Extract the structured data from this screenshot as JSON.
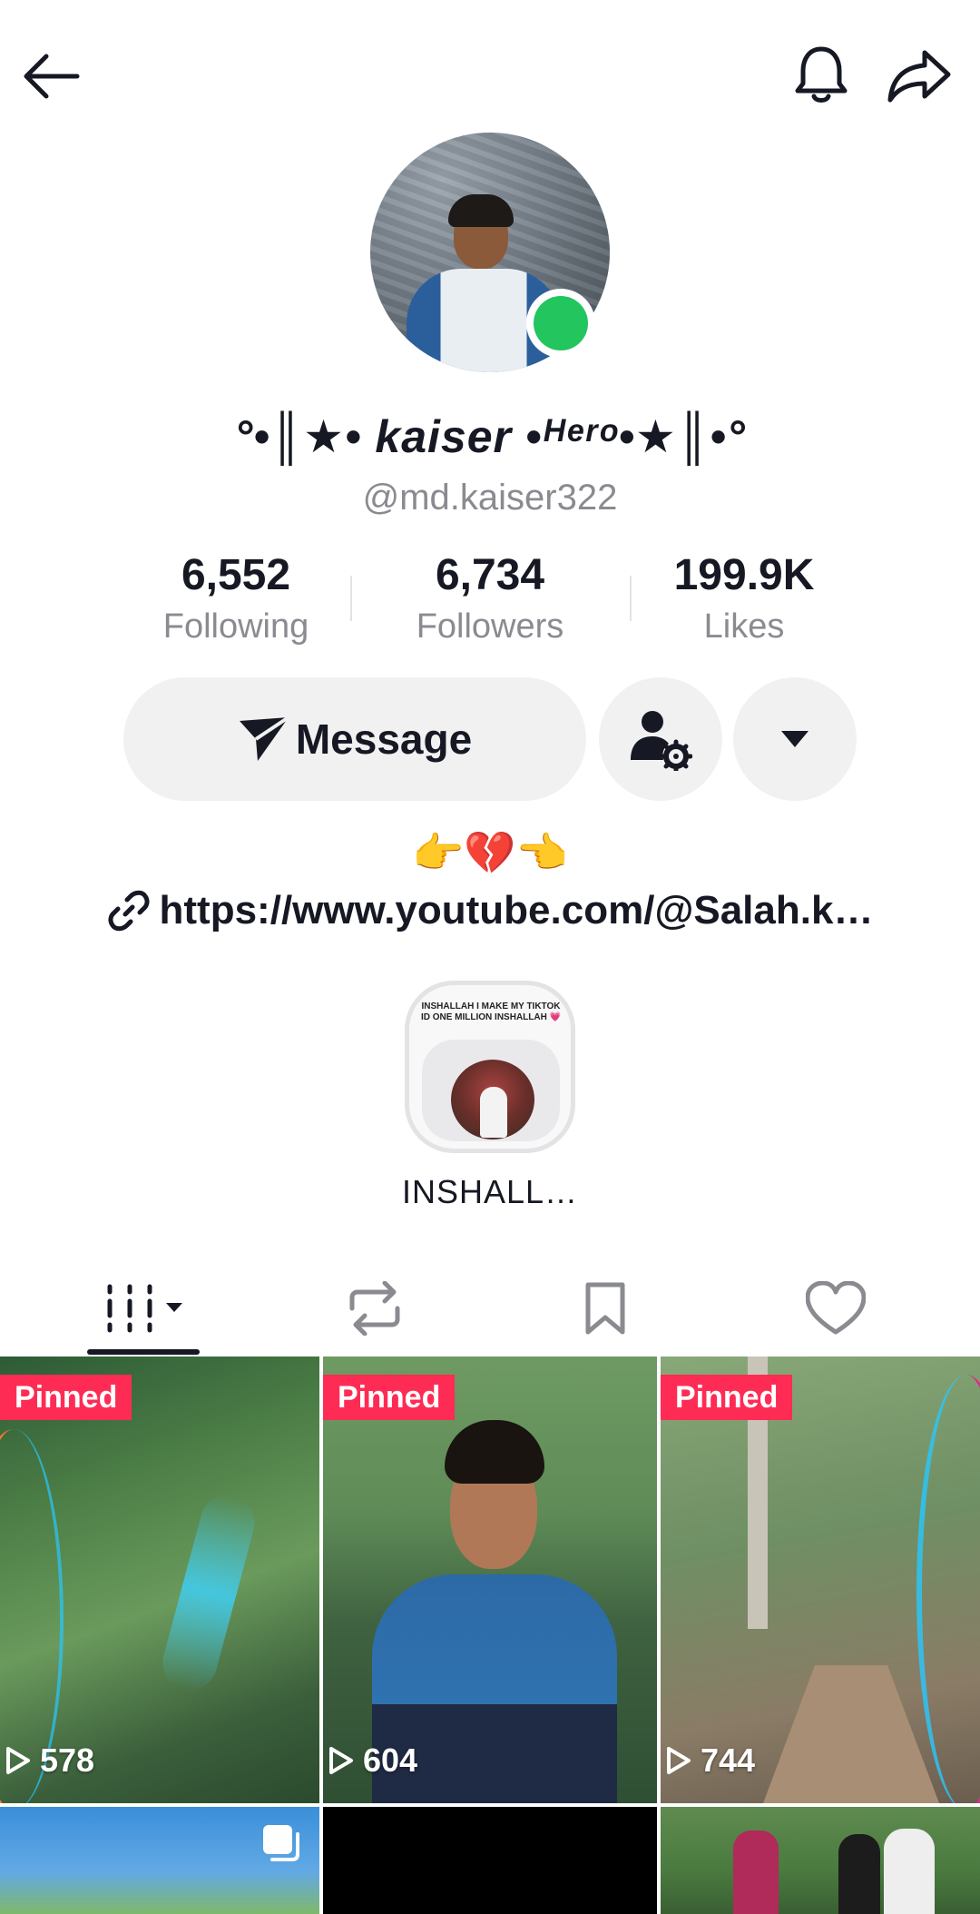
{
  "profile": {
    "display_name": "°•║★• kaiser •ᴴᵉʳᵒ•★║•°",
    "handle": "@md.kaiser322",
    "online_color": "#22c55e"
  },
  "stats": [
    {
      "value": "6,552",
      "label": "Following"
    },
    {
      "value": "6,734",
      "label": "Followers"
    },
    {
      "value": "199.9K",
      "label": "Likes"
    }
  ],
  "actions": {
    "message_label": "Message",
    "follow_icon": "user-settings-icon",
    "more_icon": "caret-down-icon"
  },
  "bio": {
    "emoji": "👉💔👈",
    "link": "https://www.youtube.com/@Salah.k…"
  },
  "highlight": {
    "thumb_text": "INSHALLAH I MAKE MY TIKTOK ID ONE MILLION INSHALLAH 💗",
    "label": "INSHALL…"
  },
  "tabs": [
    {
      "name": "videos",
      "icon": "grid-icon",
      "active": true
    },
    {
      "name": "reposts",
      "icon": "repost-icon",
      "active": false
    },
    {
      "name": "favorites",
      "icon": "bookmark-icon",
      "active": false
    },
    {
      "name": "liked",
      "icon": "heart-icon",
      "active": false
    }
  ],
  "videos": [
    {
      "pinned": "Pinned",
      "views": "578"
    },
    {
      "pinned": "Pinned",
      "views": "604"
    },
    {
      "pinned": "Pinned",
      "views": "744"
    }
  ],
  "colors": {
    "accent": "#fe2c55",
    "text": "#161823",
    "muted": "#8a8b91",
    "button_bg": "#f1f1f2"
  }
}
